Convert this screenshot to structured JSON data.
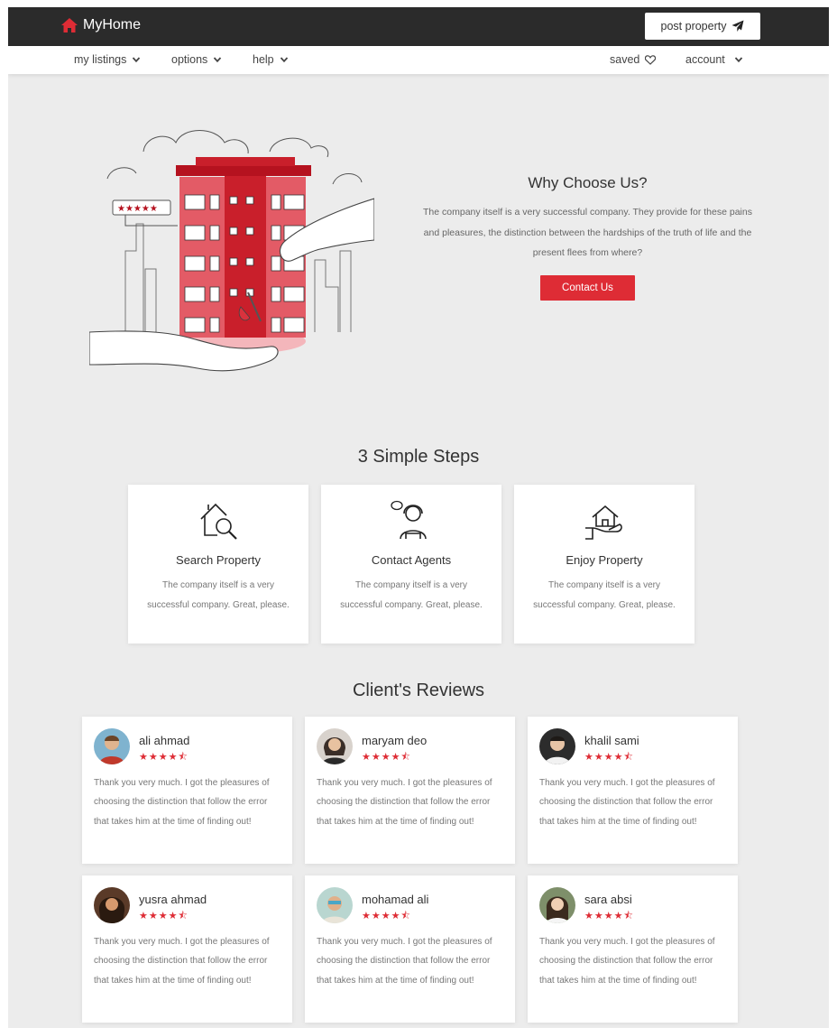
{
  "brand": {
    "name": "MyHome",
    "icon": "home-icon",
    "accent": "#de2c35"
  },
  "header": {
    "post_label": "post property",
    "post_icon": "paper-plane-icon"
  },
  "nav": {
    "left": [
      {
        "label": "my listings"
      },
      {
        "label": "options"
      },
      {
        "label": "help"
      }
    ],
    "saved_label": "saved",
    "account_label": "account"
  },
  "hero": {
    "rating_stars": "★★★★★",
    "title": "Why Choose Us?",
    "text": "The company itself is a very successful company. They provide for these pains and pleasures, the distinction between the hardships of the truth of life and the present flees from where?",
    "button_label": "Contact Us"
  },
  "steps": {
    "title": "3 Simple Steps",
    "items": [
      {
        "icon": "house-search-icon",
        "title": "Search Property",
        "text": "The company itself is a very successful company. Great, please."
      },
      {
        "icon": "agent-headset-icon",
        "title": "Contact Agents",
        "text": "The company itself is a very successful company. Great, please."
      },
      {
        "icon": "house-in-hand-icon",
        "title": "Enjoy Property",
        "text": "The company itself is a very successful company. Great, please."
      }
    ]
  },
  "reviews": {
    "title": "Client's Reviews",
    "items": [
      {
        "name": "ali ahmad",
        "rating": 4.5,
        "text": "Thank you very much. I got the pleasures of choosing the distinction that follow the error that takes him at the time of finding out!"
      },
      {
        "name": "maryam deo",
        "rating": 4.5,
        "text": "Thank you very much. I got the pleasures of choosing the distinction that follow the error that takes him at the time of finding out!"
      },
      {
        "name": "khalil sami",
        "rating": 4.5,
        "text": "Thank you very much. I got the pleasures of choosing the distinction that follow the error that takes him at the time of finding out!"
      },
      {
        "name": "yusra ahmad",
        "rating": 4.5,
        "text": "Thank you very much. I got the pleasures of choosing the distinction that follow the error that takes him at the time of finding out!"
      },
      {
        "name": "mohamad ali",
        "rating": 4.5,
        "text": "Thank you very much. I got the pleasures of choosing the distinction that follow the error that takes him at the time of finding out!"
      },
      {
        "name": "sara absi",
        "rating": 4.5,
        "text": "Thank you very much. I got the pleasures of choosing the distinction that follow the error that takes him at the time of finding out!"
      }
    ]
  }
}
